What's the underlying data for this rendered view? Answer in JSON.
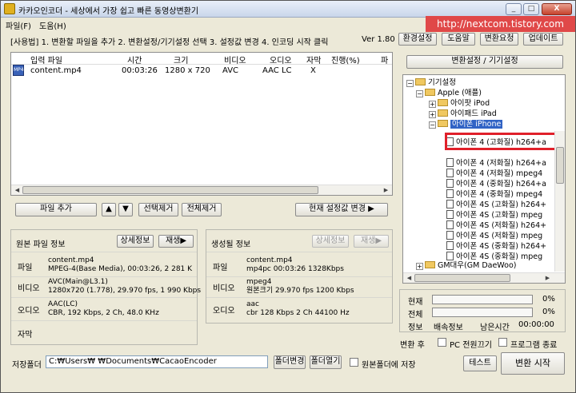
{
  "window": {
    "title": "카카오인코더 - 세상에서 가장 쉽고 빠른 동영상변환기",
    "controls": {
      "minimize": "_",
      "maximize": "□",
      "close": "X"
    }
  },
  "watermark": "http://nextcom.tistory.com",
  "menu": [
    "파일(F)",
    "도움(H)"
  ],
  "usage_text": "[사용법] 1. 변환할 파일을 추가   2. 변환설정/기기설정 선택   3. 설정값 변경   4. 인코딩 시작 클릭",
  "version": "Ver 1.80",
  "top_buttons": [
    "환경설정",
    "도움말",
    "변환요청",
    "업데이트"
  ],
  "file_list": {
    "columns": [
      "입력 파일",
      "시간",
      "크기",
      "비디오",
      "오디오",
      "자막",
      "진행(%)",
      "파"
    ],
    "rows": [
      {
        "icon": "video-file-icon",
        "name": "content.mp4",
        "time": "00:03:26",
        "size": "1280 x 720",
        "video": "AVC",
        "audio": "AAC LC",
        "subtitle": "X",
        "progress": ""
      }
    ]
  },
  "list_buttons": {
    "add_file": "파일 추가",
    "move_up": "▲",
    "move_down": "▼",
    "remove_selected": "선택제거",
    "remove_all": "전체제거",
    "apply_current": "현재 설정값 변경 ▶"
  },
  "source_info": {
    "title": "원본 파일 정보",
    "detail_button": "상세정보",
    "play_button": "재생▶",
    "rows": [
      {
        "label": "파일",
        "lines": [
          "content.mp4",
          "MPEG-4(Base Media), 00:03:26, 2 281 K"
        ]
      },
      {
        "label": "비디오",
        "lines": [
          "AVC(Main@L3.1)",
          "1280x720 (1.778), 29.970 fps, 1 990 Kbps"
        ]
      },
      {
        "label": "오디오",
        "lines": [
          "AAC(LC)",
          "CBR, 192 Kbps, 2 Ch, 48.0 KHz"
        ]
      },
      {
        "label": "자막",
        "lines": []
      }
    ]
  },
  "output_info": {
    "title": "생성될 정보",
    "detail_button": "상세정보",
    "play_button": "재생▶",
    "rows": [
      {
        "label": "파일",
        "lines": [
          "content.mp4",
          "mp4pc   00:03:26   1328Kbps"
        ]
      },
      {
        "label": "비디오",
        "lines": [
          "mpeg4",
          "원본크기   29.970 fps   1200 Kbps"
        ]
      },
      {
        "label": "오디오",
        "lines": [
          "aac",
          "cbr      128 Kbps   2 Ch   44100 Hz"
        ]
      }
    ]
  },
  "settings_tree": {
    "header": "변환설정 / 기기설정",
    "items": [
      {
        "text": "기기설정",
        "kind": "folder",
        "toggle": "−"
      },
      {
        "text": "Apple (애플)",
        "kind": "folder",
        "toggle": "−"
      },
      {
        "text": "아이팟 iPod",
        "kind": "folder",
        "toggle": "+"
      },
      {
        "text": "아이패드 iPad",
        "kind": "folder",
        "toggle": "+"
      },
      {
        "text": "아이폰 iPhone",
        "kind": "folder",
        "toggle": "−",
        "selected": true
      },
      {
        "text": "아이폰 4 (고화질) h264+a",
        "kind": "preset",
        "highlighted": true
      },
      {
        "text": "아이폰 4 (저화질) h264+a",
        "kind": "preset"
      },
      {
        "text": "아이폰 4 (저화질) mpeg4",
        "kind": "preset"
      },
      {
        "text": "아이폰 4 (중화질) h264+a",
        "kind": "preset"
      },
      {
        "text": "아이폰 4 (중화질) mpeg4",
        "kind": "preset"
      },
      {
        "text": "아이폰 4S (고화질) h264+",
        "kind": "preset"
      },
      {
        "text": "아이폰 4S (고화질) mpeg",
        "kind": "preset"
      },
      {
        "text": "아이폰 4S (저화질) h264+",
        "kind": "preset"
      },
      {
        "text": "아이폰 4S (저화질) mpeg",
        "kind": "preset"
      },
      {
        "text": "아이폰 4S (중화질) h264+",
        "kind": "preset"
      },
      {
        "text": "아이폰 4S (중화질) mpeg",
        "kind": "preset"
      },
      {
        "text": "GM대우(GM DaeWoo)",
        "kind": "folder",
        "toggle": "+"
      }
    ]
  },
  "progress": {
    "current_label": "현재",
    "current_value": "0%",
    "current_fraction": 0,
    "total_label": "전체",
    "total_value": "0%",
    "total_fraction": 0,
    "info_label": "정보",
    "speed_label": "배속정보",
    "remaining_label": "남은시간",
    "remaining_value": "00:00:00"
  },
  "after_convert": {
    "label": "변환 후",
    "pc_off": "PC 전원끄기",
    "program_exit": "프로그램 종료"
  },
  "save_folder": {
    "label": "저장폴더",
    "path": "C:₩Users₩    ₩Documents₩CacaoEncoder",
    "change_button": "폴더변경",
    "open_button": "폴더열기",
    "same_as_source": "원본폴더에 저장"
  },
  "bottom_buttons": {
    "test": "테스트",
    "start": "변환 시작"
  }
}
